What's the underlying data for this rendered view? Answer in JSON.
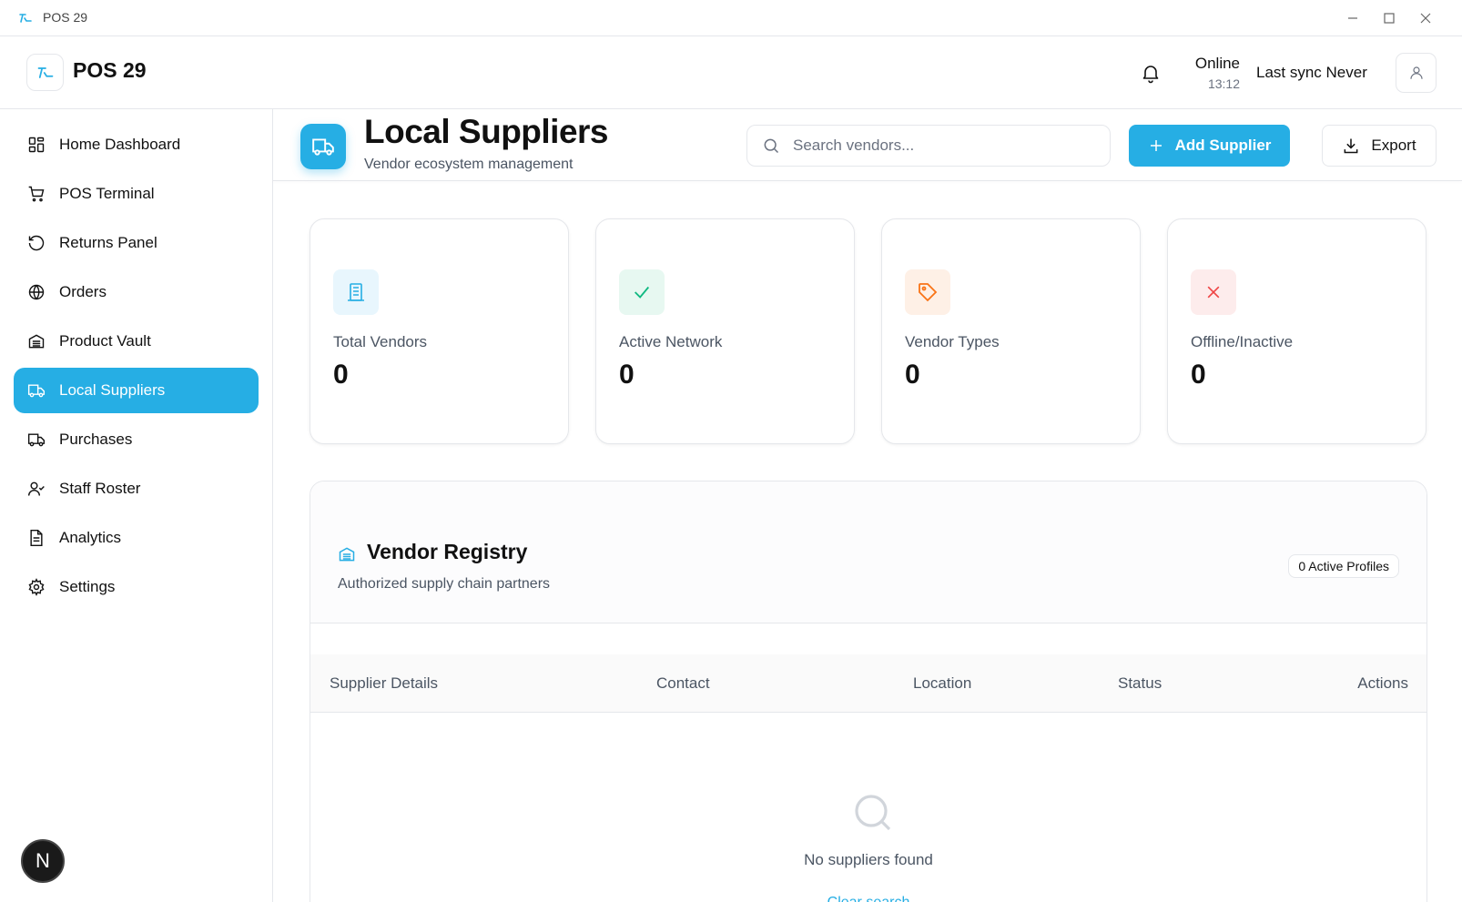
{
  "window": {
    "title": "POS 29"
  },
  "header": {
    "brand": "POS 29",
    "status": "Online",
    "status_time": "13:12",
    "sync_label": "Last sync Never"
  },
  "sidebar": {
    "items": [
      {
        "label": "Home Dashboard",
        "icon": "grid-icon"
      },
      {
        "label": "POS Terminal",
        "icon": "cart-icon"
      },
      {
        "label": "Returns Panel",
        "icon": "rotate-ccw-icon"
      },
      {
        "label": "Orders",
        "icon": "globe-icon"
      },
      {
        "label": "Product Vault",
        "icon": "vault-icon"
      },
      {
        "label": "Local Suppliers",
        "icon": "truck-icon",
        "active": true
      },
      {
        "label": "Purchases",
        "icon": "truck-icon"
      },
      {
        "label": "Staff Roster",
        "icon": "user-check-icon"
      },
      {
        "label": "Analytics",
        "icon": "file-text-icon"
      },
      {
        "label": "Settings",
        "icon": "gear-icon"
      }
    ],
    "badge": "N"
  },
  "page": {
    "title": "Local Suppliers",
    "subtitle": "Vendor ecosystem management",
    "search_placeholder": "Search vendors...",
    "add_button": "Add Supplier",
    "export_button": "Export"
  },
  "stats": [
    {
      "label": "Total Vendors",
      "value": "0",
      "icon": "building-icon",
      "color": "#26aee4"
    },
    {
      "label": "Active Network",
      "value": "0",
      "icon": "check-icon",
      "color": "#10b981"
    },
    {
      "label": "Vendor Types",
      "value": "0",
      "icon": "tag-icon",
      "color": "#f97316"
    },
    {
      "label": "Offline/Inactive",
      "value": "0",
      "icon": "x-icon",
      "color": "#ef4444"
    }
  ],
  "registry": {
    "title": "Vendor Registry",
    "subtitle": "Authorized supply chain partners",
    "badge": "0 Active Profiles",
    "columns": [
      "Supplier Details",
      "Contact",
      "Location",
      "Status",
      "Actions"
    ],
    "empty_text": "No suppliers found",
    "clear_link": "Clear search"
  },
  "colors": {
    "accent": "#26aee4"
  }
}
